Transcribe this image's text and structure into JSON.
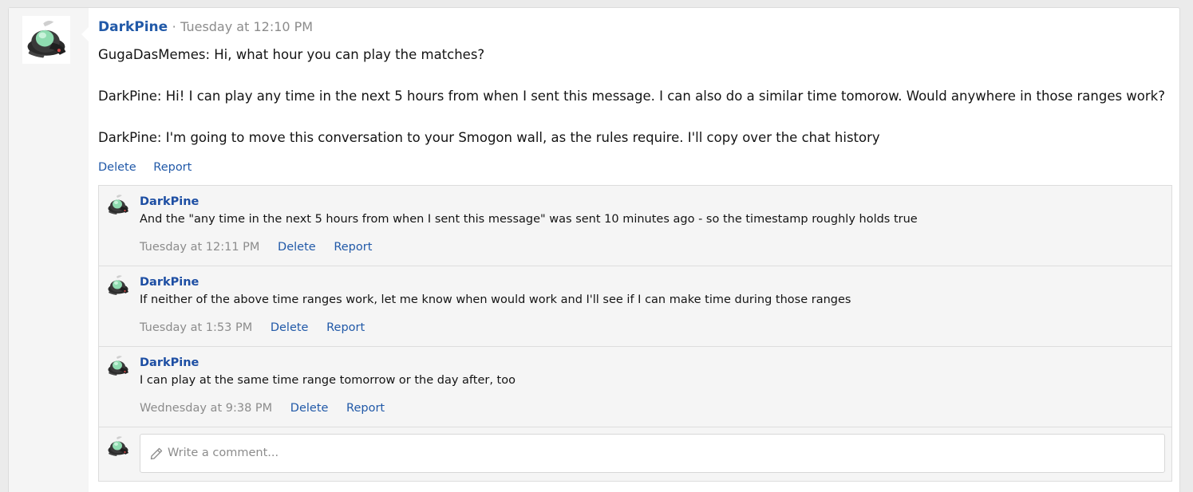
{
  "post": {
    "author": "DarkPine",
    "separator": "·",
    "time": "Tuesday at 12:10 PM",
    "lines": [
      "GugaDasMemes: Hi, what hour you can play the matches?",
      "DarkPine: Hi! I can play any time in the next 5 hours from when I sent this message. I can also do a similar time tomorow. Would anywhere in those ranges work?",
      "DarkPine: I'm going to move this conversation to your Smogon wall, as the rules require. I'll copy over the chat history"
    ],
    "actions": {
      "delete": "Delete",
      "report": "Report"
    }
  },
  "comments": [
    {
      "author": "DarkPine",
      "text": "And the \"any time in the next 5 hours from when I sent this message\" was sent 10 minutes ago - so the timestamp roughly holds true",
      "time": "Tuesday at 12:11 PM",
      "delete": "Delete",
      "report": "Report"
    },
    {
      "author": "DarkPine",
      "text": "If neither of the above time ranges work, let me know when would work and I'll see if I can make time during those ranges",
      "time": "Tuesday at 1:53 PM",
      "delete": "Delete",
      "report": "Report"
    },
    {
      "author": "DarkPine",
      "text": "I can play at the same time range tomorrow or the day after, too",
      "time": "Wednesday at 9:38 PM",
      "delete": "Delete",
      "report": "Report"
    }
  ],
  "composer": {
    "placeholder": "Write a comment..."
  },
  "icons": {
    "avatar": "pokemon-avatar-icon",
    "composer": "pencil-icon"
  },
  "colors": {
    "link": "#2159a8",
    "username": "#1d4ea3",
    "muted": "#8c8c8c"
  }
}
